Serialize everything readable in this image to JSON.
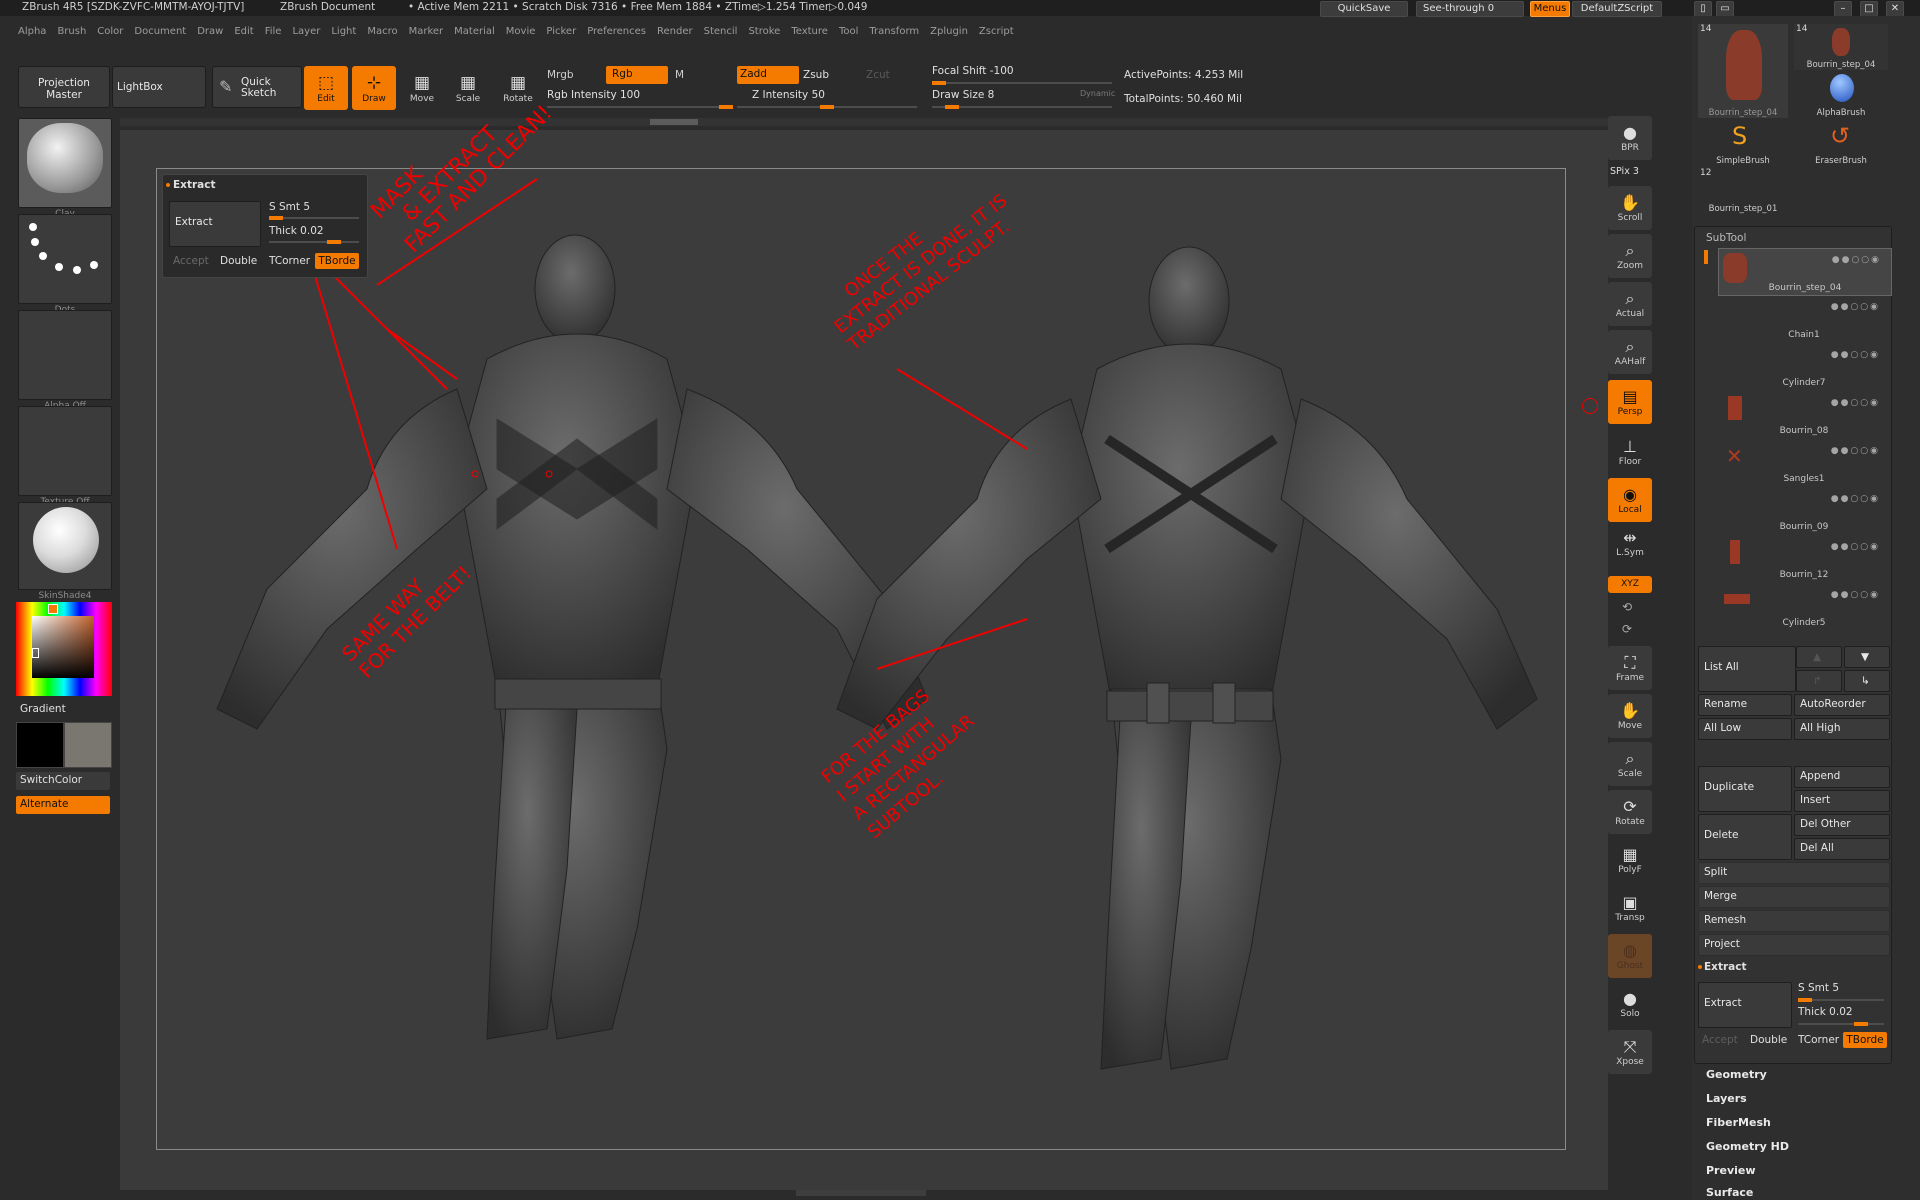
{
  "title_bar": {
    "app": "ZBrush 4R5 [SZDK-ZVFC-MMTM-AYOJ-TJTV]",
    "document": "ZBrush Document",
    "stats": "• Active Mem 2211 • Scratch Disk 7316 • Free Mem 1884 • ZTime▷1.254 Timer▷0.049",
    "quicksave": "QuickSave",
    "see_through": "See-through 0",
    "menus": "Menus",
    "script": "DefaultZScript"
  },
  "menu_bar": [
    "Alpha",
    "Brush",
    "Color",
    "Document",
    "Draw",
    "Edit",
    "File",
    "Layer",
    "Light",
    "Macro",
    "Marker",
    "Material",
    "Movie",
    "Picker",
    "Preferences",
    "Render",
    "Stencil",
    "Stroke",
    "Texture",
    "Tool",
    "Transform",
    "Zplugin",
    "Zscript"
  ],
  "top_shelf": {
    "projection_master": "Projection Master",
    "lightbox": "LightBox",
    "quick_sketch": "Quick Sketch",
    "edit": "Edit",
    "draw": "Draw",
    "move": "Move",
    "scale": "Scale",
    "rotate": "Rotate",
    "mrgb": "Mrgb",
    "rgb": "Rgb",
    "m": "M",
    "rgb_intensity": "Rgb Intensity 100",
    "zadd": "Zadd",
    "zsub": "Zsub",
    "zcut": "Zcut",
    "z_intensity": "Z Intensity 50",
    "focal_shift": "Focal Shift -100",
    "draw_size": "Draw Size 8",
    "dynamic": "Dynamic",
    "active_points": "ActivePoints: 4.253 Mil",
    "total_points": "TotalPoints: 50.460 Mil",
    "rgb_intensity_value": 100,
    "z_intensity_value": 50,
    "focal_shift_value": -100,
    "draw_size_value": 8
  },
  "left_shelf": {
    "brush": "Clay",
    "stroke": "Dots",
    "alpha": "Alpha Off",
    "texture": "Texture Off",
    "material": "SkinShade4",
    "gradient": "Gradient",
    "switch_color": "SwitchColor",
    "alternate": "Alternate"
  },
  "extract_popup": {
    "title": "Extract",
    "extract": "Extract",
    "smt": "S Smt 5",
    "thick": "Thick 0.02",
    "accept": "Accept",
    "double": "Double",
    "tcorner": "TCorner",
    "tborder": "TBorde"
  },
  "annotations": {
    "a1_line1": "MASK",
    "a1_line2": "& EXTRACT",
    "a1_line3": "FAST AND CLEAN!",
    "a2_line1": "SAME WAY",
    "a2_line2": "FOR THE BELT!",
    "a3_line1": "ONCE THE",
    "a3_line2": "EXTRACT IS DONE, IT IS",
    "a3_line3": "TRADITIONAL SCULPT.",
    "a4_line1": "FOR THE BAGS",
    "a4_line2": "I START WITH",
    "a4_line3": "A RECTANGULAR",
    "a4_line4": "SUBTOOL."
  },
  "right_shelf": {
    "bpr": "BPR",
    "spix": "SPix 3",
    "scroll": "Scroll",
    "zoom": "Zoom",
    "actual": "Actual",
    "aahalf": "AAHalf",
    "persp": "Persp",
    "floor": "Floor",
    "local": "Local",
    "lsym": "L.Sym",
    "xyz": "XYZ",
    "frame": "Frame",
    "move": "Move",
    "scale": "Scale",
    "rotate": "Rotate",
    "polyf": "PolyF",
    "transp": "Transp",
    "ghost": "Ghost",
    "solo": "Solo",
    "xpose": "Xpose"
  },
  "tool_palette": {
    "thumbs": [
      {
        "count": "14",
        "name": "Bourrin_step_04"
      },
      {
        "count": "14",
        "name": "Bourrin_step_04"
      },
      {
        "count": "",
        "name": "AlphaBrush"
      },
      {
        "count": "",
        "name": "SimpleBrush"
      },
      {
        "count": "",
        "name": "EraserBrush"
      },
      {
        "count": "12",
        "name": "Bourrin_step_01"
      }
    ]
  },
  "subtool": {
    "header": "SubTool",
    "items": [
      "Bourrin_step_04",
      "Chain1",
      "Cylinder7",
      "Bourrin_08",
      "Sangles1",
      "Bourrin_09",
      "Bourrin_12",
      "Cylinder5"
    ],
    "list_all": "List All",
    "rename": "Rename",
    "autoreorder": "AutoReorder",
    "all_low": "All Low",
    "all_high": "All High",
    "duplicate": "Duplicate",
    "append": "Append",
    "insert": "Insert",
    "delete": "Delete",
    "del_other": "Del Other",
    "del_all": "Del All",
    "split": "Split",
    "merge": "Merge",
    "remesh": "Remesh",
    "project": "Project",
    "extract_header": "Extract",
    "extract": "Extract",
    "smt": "S Smt 5",
    "thick": "Thick 0.02",
    "accept": "Accept",
    "double": "Double",
    "tcorner": "TCorner",
    "tborder": "TBorde"
  },
  "palettes": [
    "Geometry",
    "Layers",
    "FiberMesh",
    "Geometry HD",
    "Preview",
    "Surface"
  ],
  "colors": {
    "accent": "#f47a00",
    "annotation": "#f10000",
    "canvas": "#3c3c3c"
  }
}
